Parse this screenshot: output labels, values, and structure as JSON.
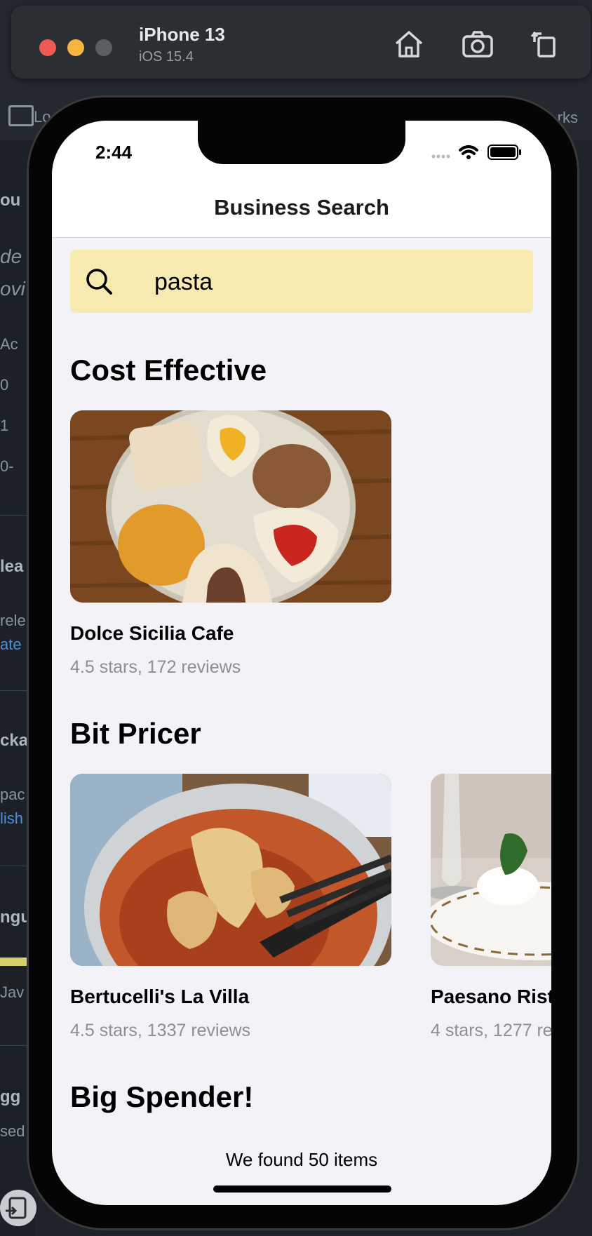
{
  "simulator": {
    "device_name": "iPhone 13",
    "os_version": "iOS 15.4",
    "toolbar": [
      "home-icon",
      "screenshot-icon",
      "rotate-icon"
    ]
  },
  "background_app": {
    "side_labels": [
      "ou",
      "de",
      "ovi",
      "Ac",
      "0",
      "1",
      "0-",
      "lea",
      "rele",
      "ate",
      "cka",
      "pac",
      "lish",
      "ngu",
      "Jav",
      "gg",
      "sed"
    ],
    "right_label": "rks",
    "top_label": "Lo"
  },
  "status_bar": {
    "time": "2:44"
  },
  "nav": {
    "title": "Business Search"
  },
  "search": {
    "value": "pasta",
    "icon": "search-icon"
  },
  "sections": [
    {
      "title": "Cost Effective",
      "cards": [
        {
          "name": "Dolce Sicilia Cafe",
          "rating": "4.5 stars, 172 reviews"
        }
      ]
    },
    {
      "title": "Bit Pricer",
      "cards": [
        {
          "name": "Bertucelli's La Villa",
          "rating": "4.5 stars, 1337 reviews"
        },
        {
          "name": "Paesano Rist",
          "rating": "4 stars, 1277 re"
        }
      ]
    },
    {
      "title": "Big Spender!",
      "cards": []
    }
  ],
  "footer": {
    "text": "We found 50 items"
  },
  "colors": {
    "search_bg": "#f7eab1",
    "screen_bg": "#f2f2f7",
    "rating_gray": "#8e8e93"
  }
}
